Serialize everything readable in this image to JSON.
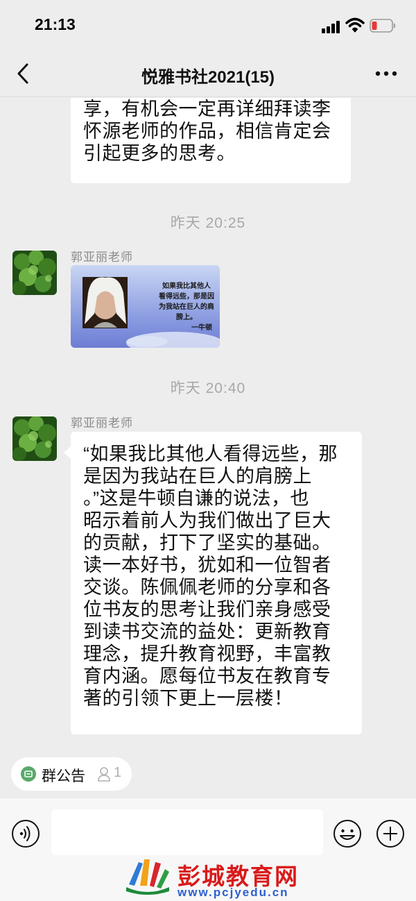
{
  "status_bar": {
    "time": "21:13",
    "battery_color": "#e53935"
  },
  "nav": {
    "title": "悦雅书社2021(15)"
  },
  "messages": {
    "partial_bubble": {
      "lines": [
        "享，有机会一定再详细拜读李",
        "怀源老师的作品，相信肯定会",
        "引起更多的思考。"
      ]
    },
    "timestamp_1": "昨天 20:25",
    "msg_1": {
      "sender": "郭亚丽老师",
      "image": {
        "quote_lines": [
          "如果我比其他人",
          "看得远些，那是因",
          "为我站在巨人的肩",
          "膀上。"
        ],
        "signature": "一牛顿"
      }
    },
    "timestamp_2": "昨天 20:40",
    "msg_2": {
      "sender": "郭亚丽老师",
      "lines": [
        "“如果我比其他人看得远些，那",
        "是因为我站在巨人的肩膀上",
        "。”这是牛顿自谦的说法，也",
        "昭示着前人为我们做出了巨大",
        "的贡献，打下了坚实的基础。",
        "读一本好书，犹如和一位智者",
        "交谈。陈佩佩老师的分享和各",
        "位书友的思考让我们亲身感受",
        "到读书交流的益处：更新教育",
        "理念，提升教育视野，丰富教",
        "育内涵。愿每位书友在教育专",
        "著的引领下更上一层楼！"
      ]
    }
  },
  "notice": {
    "label": "群公告",
    "count": "1"
  },
  "input": {
    "placeholder": ""
  },
  "watermark": {
    "text": "彭城教育网",
    "url": "www.pcjyedu.cn"
  },
  "colors": {
    "background": "#ededed",
    "bubble": "#ffffff",
    "timestamp": "#a8a8a8",
    "watermark_red": "#d91a1a",
    "watermark_blue": "#2c5fd0"
  }
}
